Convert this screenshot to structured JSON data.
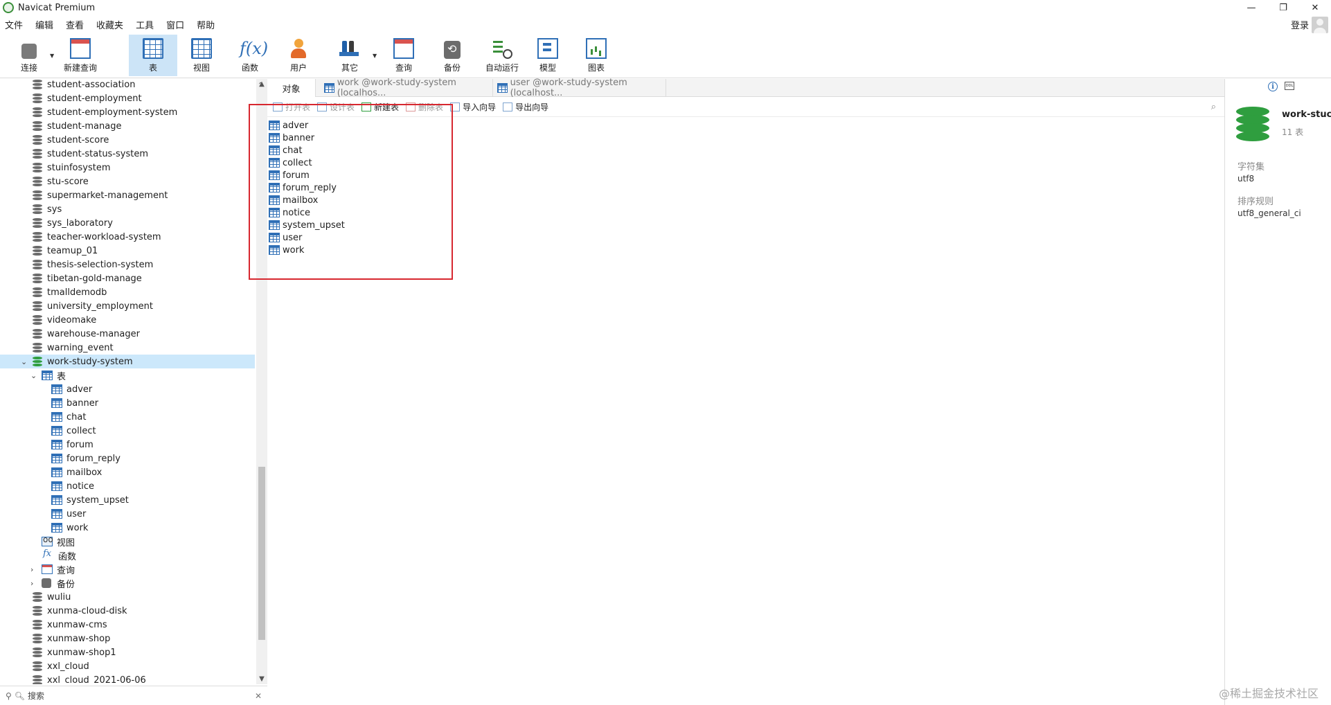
{
  "window": {
    "title": "Navicat Premium",
    "controls": {
      "minimize": "—",
      "restore": "❐",
      "close": "✕"
    }
  },
  "menu": {
    "items": [
      "文件",
      "编辑",
      "查看",
      "收藏夹",
      "工具",
      "窗口",
      "帮助"
    ],
    "login": "登录"
  },
  "toolbar": {
    "connect": "连接",
    "new_query": "新建查询",
    "table": "表",
    "view": "视图",
    "function": "函数",
    "user": "用户",
    "other": "其它",
    "query": "查询",
    "backup": "备份",
    "automation": "自动运行",
    "model": "模型",
    "chart": "图表",
    "active": "表"
  },
  "nav": {
    "databases_before": [
      "student-association",
      "student-employment",
      "student-employment-system",
      "student-manage",
      "student-score",
      "student-status-system",
      "stuinfosystem",
      "stu-score",
      "supermarket-management",
      "sys",
      "sys_laboratory",
      "teacher-workload-system",
      "teamup_01",
      "thesis-selection-system",
      "tibetan-gold-manage",
      "tmalldemodb",
      "university_employment",
      "videomake",
      "warehouse-manager",
      "warning_event"
    ],
    "selected_db": "work-study-system",
    "tables_label": "表",
    "tables": [
      "adver",
      "banner",
      "chat",
      "collect",
      "forum",
      "forum_reply",
      "mailbox",
      "notice",
      "system_upset",
      "user",
      "work"
    ],
    "views_label": "视图",
    "functions_label": "函数",
    "queries_label": "查询",
    "backups_label": "备份",
    "databases_after": [
      "wuliu",
      "xunma-cloud-disk",
      "xunmaw-cms",
      "xunmaw-shop",
      "xunmaw-shop1",
      "xxl_cloud",
      "xxl_cloud_2021-06-06"
    ],
    "search_placeholder": "搜索"
  },
  "tabs": {
    "objects": "对象",
    "doc1": "work @work-study-system (localhos...",
    "doc2": "user @work-study-system (localhost..."
  },
  "object_toolbar": {
    "open_table": "打开表",
    "design_table": "设计表",
    "new_table": "新建表",
    "delete_table": "删除表",
    "import_wizard": "导入向导",
    "export_wizard": "导出向导"
  },
  "objects": [
    "adver",
    "banner",
    "chat",
    "collect",
    "forum",
    "forum_reply",
    "mailbox",
    "notice",
    "system_upset",
    "user",
    "work"
  ],
  "info": {
    "name": "work-stuc",
    "count": "11 表",
    "charset_label": "字符集",
    "charset_value": "utf8",
    "collation_label": "排序规则",
    "collation_value": "utf8_general_ci",
    "icon_ddl": "DDL"
  },
  "watermark": "@稀土掘金技术社区",
  "colors": {
    "selection": "#cce8fb",
    "toolbar_active": "#cce4f7",
    "highlight_box": "#d7272f",
    "db_green": "#2f9e3f"
  }
}
